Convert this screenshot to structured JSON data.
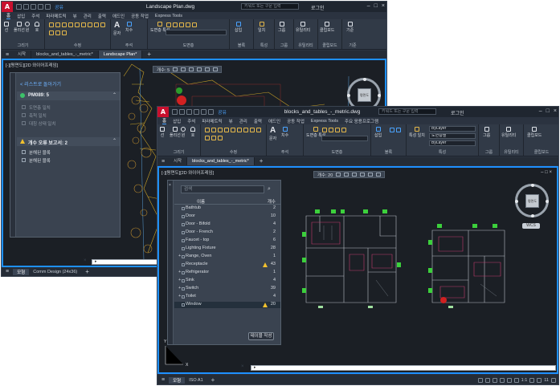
{
  "back_window": {
    "title": "Landscape Plan.dwg",
    "share": "공유",
    "search_placeholder": "키워드 또는 구문 입력",
    "login": "로그인",
    "menu": [
      "홈",
      "삽입",
      "주석",
      "파라메트릭",
      "뷰",
      "관리",
      "출력",
      "애드인",
      "공동 작업",
      "Express Tools"
    ],
    "ribbon_groups": [
      "그리기",
      "수정",
      "주석",
      "도면층",
      "블록",
      "특성",
      "그룹",
      "유틸리티",
      "클립보드",
      "기준"
    ],
    "ribbon_tools": {
      "line": "선",
      "polyline": "폴리선",
      "circle": "원",
      "arc": "호",
      "text": "문자",
      "dimension": "치수",
      "layer_properties": "도면층 특성",
      "insert": "삽입",
      "match": "일치",
      "group": "그룹",
      "utility": "유틸리티",
      "clipboard": "클립보드",
      "base": "기준"
    },
    "doc_tabs": [
      "시작",
      "blocks_and_tables_-_metric*",
      "Landscape Plan*"
    ],
    "viewport_label": "[-][평면도][2D 와이어프레임]",
    "count_toolbar": "개수: 5",
    "panel": {
      "back_link": "< 리스트로 돌아가기",
      "block_name": "PM089: 5",
      "options": [
        "도면층 일치",
        "축척 일치",
        "대칭 상태 일치"
      ],
      "warning_header": "개수 오류 보고서: 2",
      "warning_items": [
        "분해된 블록",
        "분해된 블록"
      ]
    },
    "status_tabs": [
      "모형",
      "Comm Design (24x36)"
    ],
    "viewcube_face": "평면도"
  },
  "front_window": {
    "title": "blocks_and_tables_-_metric.dwg",
    "share": "공유",
    "search_placeholder": "키워드 또는 구문 입력",
    "login": "로그인",
    "menu": [
      "홈",
      "삽입",
      "주석",
      "파라메트릭",
      "뷰",
      "관리",
      "출력",
      "애드인",
      "공동 작업",
      "Express Tools",
      "주요 응용프로그램"
    ],
    "ribbon_groups": [
      "그리기",
      "수정",
      "주석",
      "도면층",
      "블록",
      "특성",
      "그룹",
      "유틸리티",
      "클립보드"
    ],
    "ribbon_tools": {
      "line": "선",
      "polyline": "폴리선",
      "circle": "원",
      "arc": "호",
      "text": "문자",
      "dimension": "치수",
      "layer_properties": "도면층 특성",
      "insert": "삽입",
      "match": "특성 일치",
      "group": "그룹",
      "utility": "유틸리티",
      "clipboard": "클립보드"
    },
    "property_dropdowns": [
      "ByLayer",
      "도면층별",
      "ByLayer"
    ],
    "doc_tabs": [
      "시작",
      "blocks_and_tables_-_metric*"
    ],
    "viewport_label": "[-][평면도][2D 와이어프레임]",
    "count_toolbar": "개수: 20",
    "wcs_label": "WCS",
    "panel": {
      "search_placeholder": "검색",
      "col_name": "이름",
      "col_count": "개수",
      "rows": [
        {
          "name": "Bathtub",
          "count": "2",
          "expand": "",
          "warn": false
        },
        {
          "name": "Door",
          "count": "10",
          "expand": "",
          "warn": false
        },
        {
          "name": "Door - Bifold",
          "count": "4",
          "expand": "",
          "warn": false
        },
        {
          "name": "Door - French",
          "count": "2",
          "expand": "",
          "warn": false
        },
        {
          "name": "Faucet - top",
          "count": "6",
          "expand": "",
          "warn": false
        },
        {
          "name": "Lighting Fixture",
          "count": "28",
          "expand": "",
          "warn": false
        },
        {
          "name": "Range, Oven",
          "count": "1",
          "expand": "+",
          "warn": false
        },
        {
          "name": "Receptacle",
          "count": "43",
          "expand": "",
          "warn": true
        },
        {
          "name": "Refrigerator",
          "count": "1",
          "expand": "+",
          "warn": false
        },
        {
          "name": "Sink",
          "count": "4",
          "expand": "+",
          "warn": false
        },
        {
          "name": "Switch",
          "count": "39",
          "expand": "+",
          "warn": false
        },
        {
          "name": "Toilet",
          "count": "4",
          "expand": "+",
          "warn": false
        },
        {
          "name": "Window",
          "count": "20",
          "expand": "",
          "warn": true
        }
      ],
      "create_table": "테이블 작성"
    },
    "status_tabs": [
      "모형",
      "ISO A1"
    ],
    "status_scale": "1:1",
    "status_count": "11",
    "viewcube_face": "평면도"
  }
}
